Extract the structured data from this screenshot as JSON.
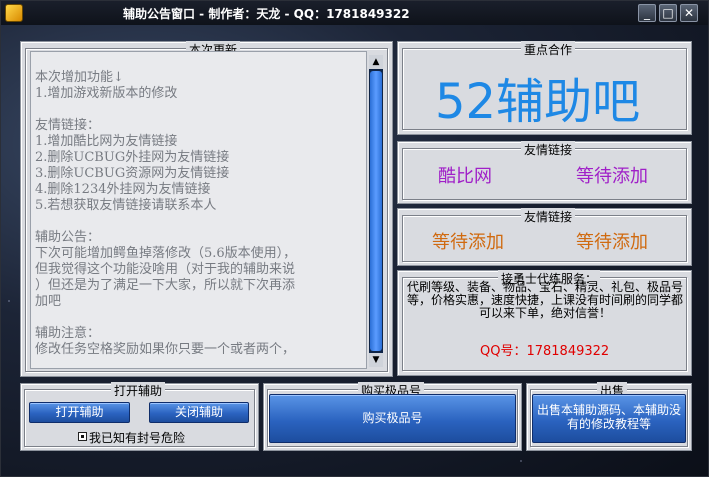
{
  "window": {
    "title": "辅助公告窗口 - 制作者：天龙 - QQ：1781849322",
    "min_label": "_",
    "max_label": "□",
    "close_label": "✕"
  },
  "updates": {
    "group_label": "本次更新",
    "lines": [
      "本次增加功能↓",
      "1.增加游戏新版本的修改",
      "",
      "友情链接：",
      "1.增加酷比网为友情链接",
      "2.删除UCBUG外挂网为友情链接",
      "3.删除UCBUG资源网为友情链接",
      "4.删除1234外挂网为友情链接",
      "5.若想获取友情链接请联系本人",
      "",
      "辅助公告：",
      "下次可能增加鳄鱼掉落修改（5.6版本使用），",
      "但我觉得这个功能没啥用（对于我的辅助来说",
      "）但还是为了满足一下大家，所以就下次再添",
      "加吧",
      "",
      "辅助注意：",
      "修改任务空格奖励如果你只要一个或者两个，"
    ]
  },
  "partner": {
    "group_label": "重点合作",
    "name": "52辅助吧"
  },
  "links1": {
    "group_label": "友情链接",
    "left": "酷比网",
    "right": "等待添加"
  },
  "links2": {
    "group_label": "友情链接",
    "left": "等待添加",
    "right": "等待添加"
  },
  "service": {
    "group_label": "接勇士代练服务：",
    "description": "代刷等级、装备、物品、宝石、精灵、礼包、极品号等，价格实惠，速度快捷，上课没有时间刷的同学都可以来下单，绝对信誉！",
    "qq": "QQ号：1781849322"
  },
  "assist": {
    "group_label": "打开辅助",
    "open_label": "打开辅助",
    "close_label": "关闭辅助",
    "risk_label": "我已知有封号危险"
  },
  "buy": {
    "group_label": "购买极品号",
    "button_label": "购买极品号"
  },
  "sale": {
    "group_label": "出售",
    "button_label": "出售本辅助源码、本辅助没有的修改教程等"
  },
  "colors": {
    "partner": "#1e88e5",
    "link_purple": "#a020c8",
    "link_orange": "#d06a10",
    "qq_red": "#e00000"
  }
}
